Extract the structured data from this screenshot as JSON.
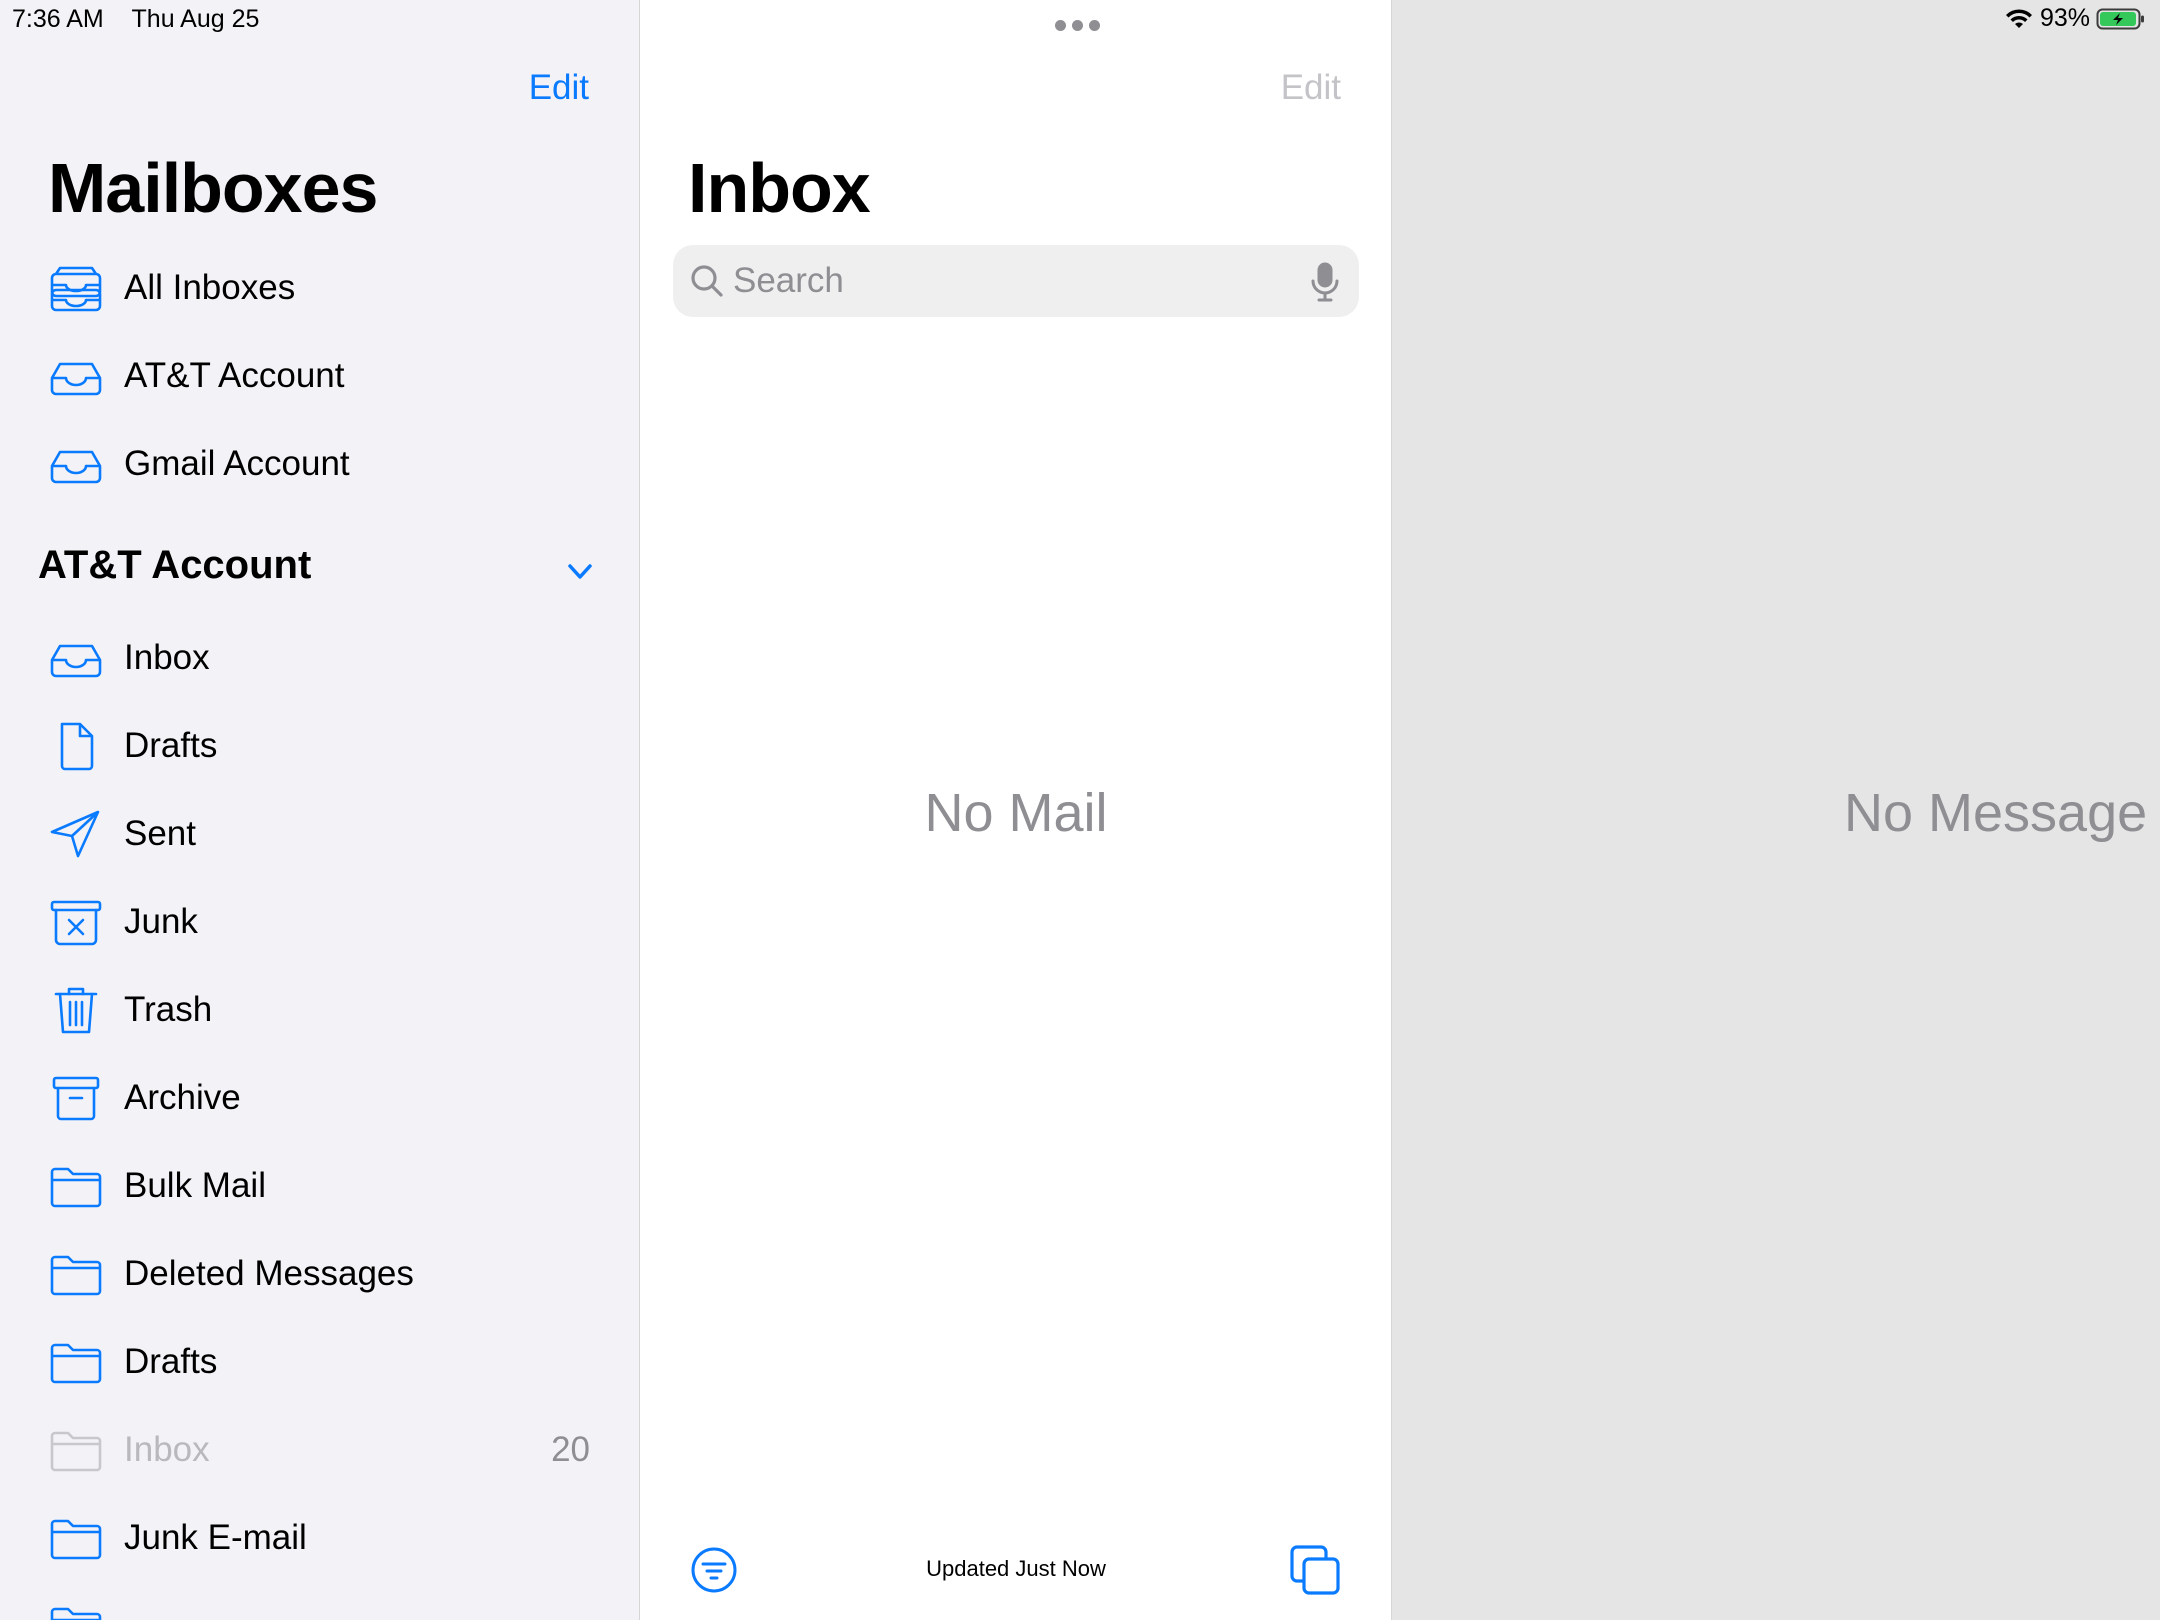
{
  "status_bar": {
    "time": "7:36 AM",
    "date": "Thu Aug 25",
    "battery": "93%",
    "wifi_icon": "wifi-icon",
    "battery_icon": "battery-charging-icon"
  },
  "sidebar": {
    "edit_label": "Edit",
    "title": "Mailboxes",
    "top_items": [
      {
        "label": "All Inboxes",
        "icon": "tray-stack-icon"
      },
      {
        "label": "AT&T Account",
        "icon": "tray-icon"
      },
      {
        "label": "Gmail Account",
        "icon": "tray-icon"
      }
    ],
    "section": {
      "title": "AT&T Account",
      "chevron_icon": "chevron-down-icon",
      "items": [
        {
          "label": "Inbox",
          "icon": "tray-icon"
        },
        {
          "label": "Drafts",
          "icon": "doc-icon"
        },
        {
          "label": "Sent",
          "icon": "paperplane-icon"
        },
        {
          "label": "Junk",
          "icon": "xmark-bin-icon"
        },
        {
          "label": "Trash",
          "icon": "trash-icon"
        },
        {
          "label": "Archive",
          "icon": "archivebox-icon"
        },
        {
          "label": "Bulk Mail",
          "icon": "folder-icon"
        },
        {
          "label": "Deleted Messages",
          "icon": "folder-icon"
        },
        {
          "label": "Drafts",
          "icon": "folder-icon"
        },
        {
          "label": "Inbox",
          "icon": "folder-icon",
          "count": "20",
          "dimmed": true
        },
        {
          "label": "Junk E-mail",
          "icon": "folder-icon"
        }
      ]
    }
  },
  "list": {
    "edit_label": "Edit",
    "title": "Inbox",
    "search_placeholder": "Search",
    "empty_text": "No Mail",
    "updated_text": "Updated Just Now"
  },
  "detail": {
    "empty_text": "No Message Selected"
  },
  "colors": {
    "accent": "#0a7aff",
    "sidebar_bg": "#f2f2f7",
    "secondary_text": "#8e8e93",
    "detail_bg": "#e5e5e5"
  }
}
